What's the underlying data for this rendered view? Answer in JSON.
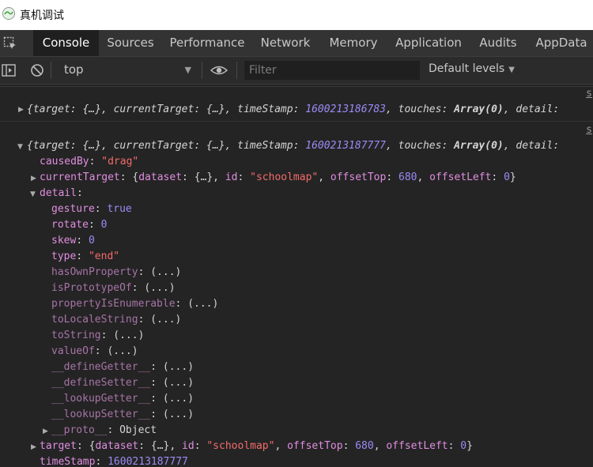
{
  "window": {
    "title": "真机调试"
  },
  "tabs": [
    {
      "label": "Console",
      "active": true
    },
    {
      "label": "Sources"
    },
    {
      "label": "Performance"
    },
    {
      "label": "Network"
    },
    {
      "label": "Memory"
    },
    {
      "label": "Application"
    },
    {
      "label": "Audits"
    },
    {
      "label": "AppData"
    }
  ],
  "toolbar": {
    "context": "top",
    "filter_placeholder": "Filter",
    "levels": "Default levels"
  },
  "messages": [
    {
      "source": "s",
      "summary": {
        "target": "{…}",
        "currentTarget": "{…}",
        "timeStamp": "1600213186783",
        "touches": "Array(0)",
        "tail": "detail:"
      }
    },
    {
      "source": "s",
      "summary": {
        "target": "{…}",
        "currentTarget": "{…}",
        "timeStamp": "1600213187777",
        "touches": "Array(0)",
        "tail": "detail:"
      },
      "causedBy": "\"drag\"",
      "currentTarget": {
        "dataset": "{…}",
        "id": "\"schoolmap\"",
        "offsetTop": "680",
        "offsetLeft": "0"
      },
      "detail": {
        "gesture": "true",
        "rotate": "0",
        "skew": "0",
        "type": "\"end\"",
        "methods": [
          "hasOwnProperty",
          "isPrototypeOf",
          "propertyIsEnumerable",
          "toLocaleString",
          "toString",
          "valueOf",
          "__defineGetter__",
          "__defineSetter__",
          "__lookupGetter__",
          "__lookupSetter__"
        ],
        "method_value": "(...)",
        "proto_key": "__proto__",
        "proto_value": "Object"
      },
      "target": {
        "dataset": "{…}",
        "id": "\"schoolmap\"",
        "offsetTop": "680",
        "offsetLeft": "0"
      },
      "timeStamp": "1600213187777"
    }
  ],
  "labels": {
    "target": "target",
    "currentTarget": "currentTarget",
    "timeStamp": "timeStamp",
    "touches": "touches",
    "causedBy": "causedBy",
    "detail": "detail",
    "gesture": "gesture",
    "rotate": "rotate",
    "skew": "skew",
    "type": "type",
    "dataset": "dataset",
    "id": "id",
    "offsetTop": "offsetTop",
    "offsetLeft": "offsetLeft"
  },
  "colors": {
    "background": "#242424",
    "key": "#e08ee0",
    "string": "#f36b6b",
    "number": "#9b8bf5"
  }
}
